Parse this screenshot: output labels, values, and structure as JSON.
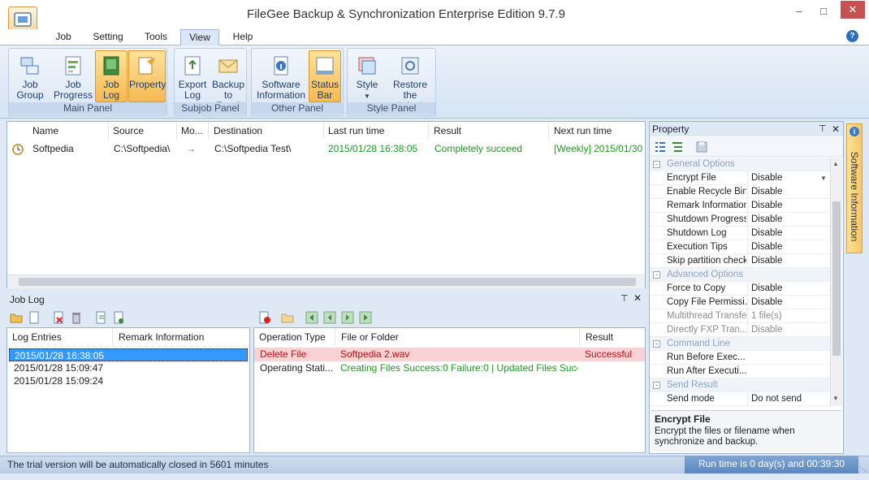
{
  "window": {
    "title": "FileGee Backup & Synchronization Enterprise Edition 9.7.9",
    "min_icon": "minimize-icon",
    "max_icon": "maximize-icon",
    "close_icon": "close-icon"
  },
  "tabs": [
    "Job",
    "Setting",
    "Tools",
    "View",
    "Help"
  ],
  "ribbon": {
    "groups": [
      {
        "label": "Main Panel",
        "buttons": [
          "Job Group",
          "Job Progress",
          "Job Log",
          "Property"
        ]
      },
      {
        "label": "Subjob Panel",
        "buttons": [
          "Export Log",
          "Backup to Email"
        ]
      },
      {
        "label": "Other Panel",
        "buttons": [
          "Software Information",
          "Status Bar"
        ]
      },
      {
        "label": "Style Panel",
        "buttons": [
          "Style",
          "Restore the default"
        ]
      }
    ],
    "btn_lines": {
      "job_group": [
        "Job",
        "Group"
      ],
      "job_progress": [
        "Job",
        "Progress"
      ],
      "job_log": [
        "Job",
        "Log"
      ],
      "property": [
        "Property"
      ],
      "export_log": [
        "Export",
        "Log"
      ],
      "backup_email": [
        "Backup",
        "to Email"
      ],
      "software_info": [
        "Software",
        "Information"
      ],
      "status_bar": [
        "Status",
        "Bar"
      ],
      "style": [
        "Style"
      ],
      "restore": [
        "Restore",
        "the default"
      ]
    }
  },
  "jobs": {
    "headers": [
      "Name",
      "Source",
      "Mo...",
      "Destination",
      "Last run time",
      "Result",
      "Next run time"
    ],
    "rows": [
      {
        "name": "Softpedia",
        "source": "C:\\Softpedia\\",
        "mode": "→",
        "destination": "C:\\Softpedia Test\\",
        "last_run": "2015/01/28 16:38:05",
        "result": "Completely succeed",
        "next_run": "[Weekly] 2015/01/30"
      }
    ]
  },
  "job_log": {
    "title": "Job Log",
    "left_headers": [
      "Log Entries",
      "Remark Information"
    ],
    "entries": [
      "2015/01/28 16:38:05",
      "2015/01/28 15:09:47",
      "2015/01/28 15:09:24"
    ],
    "right_headers": [
      "Operation Type",
      "File or Folder",
      "Result"
    ],
    "rows": [
      {
        "type": "Delete File",
        "file": "Softpedia 2.wav",
        "result": "Successful"
      },
      {
        "type": "Operating Stati...",
        "file": "Creating Files Success:0 Failure:0 | Updated Files Succ...",
        "result": ""
      }
    ]
  },
  "property": {
    "title": "Property",
    "categories": [
      {
        "name": "General Options",
        "items": [
          [
            "Encrypt File",
            "Disable"
          ],
          [
            "Enable Recycle Bin",
            "Disable"
          ],
          [
            "Remark Information",
            "Disable"
          ],
          [
            "Shutdown Progress",
            "Disable"
          ],
          [
            "Shutdown Log",
            "Disable"
          ],
          [
            "Execution Tips",
            "Disable"
          ],
          [
            "Skip partition check",
            "Disable"
          ]
        ]
      },
      {
        "name": "Advanced Options",
        "items": [
          [
            "Force to Copy",
            "Disable"
          ],
          [
            "Copy File Permissi...",
            "Disable"
          ],
          [
            "Multithread Transfer",
            "1 file(s)"
          ],
          [
            "Directly FXP Tran...",
            "Disable"
          ]
        ]
      },
      {
        "name": "Command Line",
        "items": [
          [
            "Run Before Exec...",
            ""
          ],
          [
            "Run After Executi...",
            ""
          ]
        ]
      },
      {
        "name": "Send Result",
        "items": [
          [
            "Send mode",
            "Do not send"
          ]
        ]
      }
    ],
    "desc_title": "Encrypt File",
    "desc_text": "Encrypt the files or filename when synchronize and backup."
  },
  "side_tab": "Software Information",
  "status": {
    "left": "The trial version will be automatically closed in 5601 minutes",
    "right": "Run time is 0 day(s) and 00:39:30"
  },
  "colors": {
    "accent": "#f7b953",
    "success": "#1e9a1e",
    "selection": "#3399ff",
    "delete_row": "#f9d3d3"
  }
}
